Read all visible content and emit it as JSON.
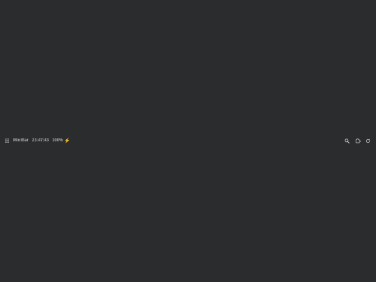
{
  "minibar": {
    "app_name": "MiniBar",
    "time": "23:47:43",
    "battery_percent": "100%",
    "charging": true,
    "left_icons": [
      "apps-grid-icon"
    ],
    "right_icons": [
      "search-icon",
      "extension-icon",
      "refresh-icon"
    ]
  },
  "colors": {
    "background": "#2b2c2e",
    "text": "#a9abae",
    "charging_bolt": "#e3b341"
  }
}
